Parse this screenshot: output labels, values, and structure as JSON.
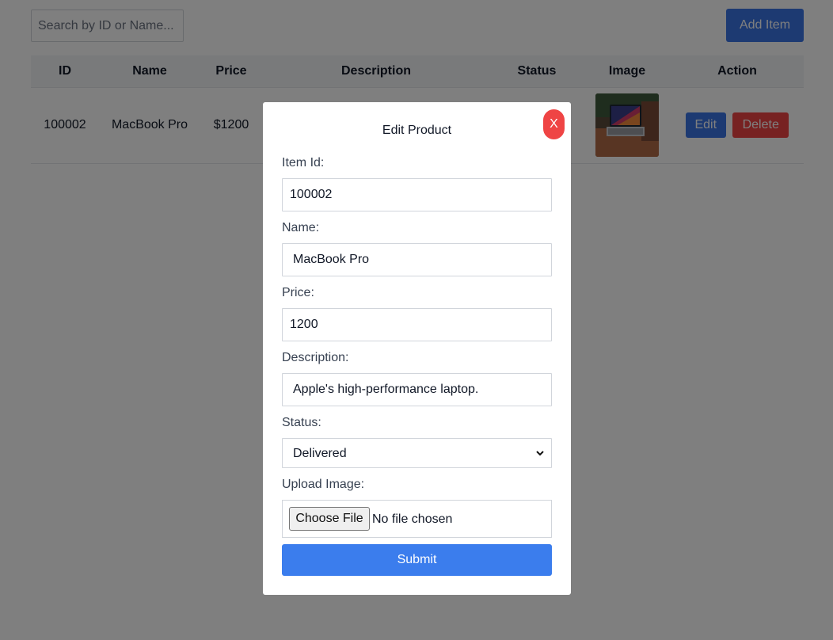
{
  "toolbar": {
    "search_placeholder": "Search by ID or Name...",
    "add_label": "Add Item"
  },
  "table": {
    "headers": {
      "id": "ID",
      "name": "Name",
      "price": "Price",
      "description": "Description",
      "status": "Status",
      "image": "Image",
      "action": "Action"
    },
    "rows": [
      {
        "id": "100002",
        "name": "MacBook Pro",
        "price": "$1200",
        "edit_label": "Edit",
        "delete_label": "Delete"
      }
    ]
  },
  "modal": {
    "title": "Edit Product",
    "close_label": "X",
    "item_id_label": "Item Id:",
    "item_id_value": "100002",
    "name_label": "Name:",
    "name_value": "MacBook Pro",
    "price_label": "Price:",
    "price_value": "1200",
    "description_label": "Description:",
    "description_value": "Apple's high-performance laptop.",
    "status_label": "Status:",
    "status_value": "Delivered",
    "upload_label": "Upload Image:",
    "choose_file_label": "Choose File",
    "file_status": "No file chosen",
    "submit_label": "Submit"
  },
  "colors": {
    "primary": "#3b74e5",
    "danger": "#ef4444",
    "overlay": "rgba(0,0,0,0.5)"
  }
}
